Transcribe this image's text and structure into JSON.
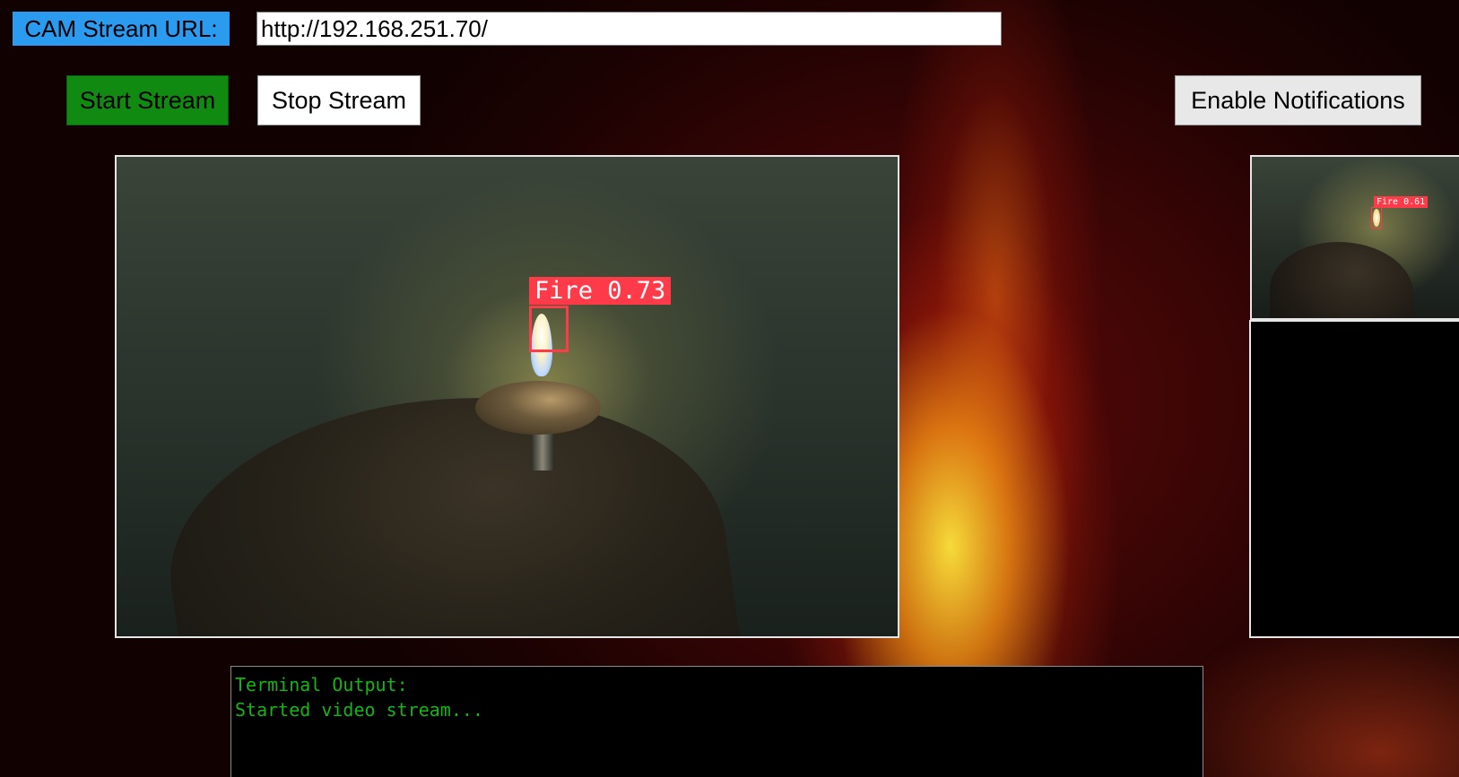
{
  "header": {
    "url_label": "CAM Stream URL:",
    "url_value": "http://192.168.251.70/"
  },
  "controls": {
    "start_label": "Start Stream",
    "stop_label": "Stop Stream",
    "notify_label": "Enable Notifications"
  },
  "detections": {
    "main_label": "Fire 0.73",
    "thumb_label": "Fire 0.61"
  },
  "terminal": {
    "lines": [
      "Terminal Output:",
      "Started video stream..."
    ]
  },
  "colors": {
    "url_label_bg": "#2b9bef",
    "start_button_bg": "#118a11",
    "detection_box": "#ff3b4a",
    "terminal_text": "#17b417"
  }
}
